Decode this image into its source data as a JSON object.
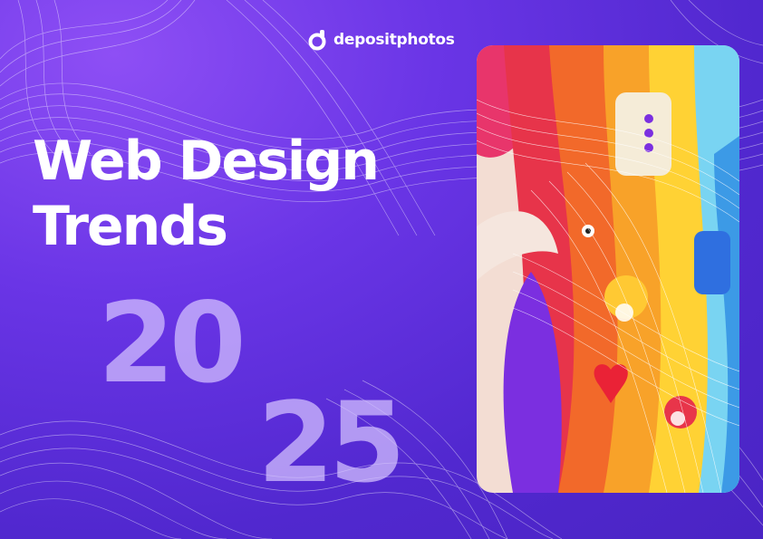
{
  "brand": {
    "name": "depositphotos"
  },
  "headline": {
    "line1": "Web Design",
    "line2": "Trends"
  },
  "year": {
    "part1": "20",
    "part2": "25"
  },
  "colors": {
    "background": "#5b2fd9",
    "text": "#ffffff",
    "year": "#d6c4ff"
  }
}
